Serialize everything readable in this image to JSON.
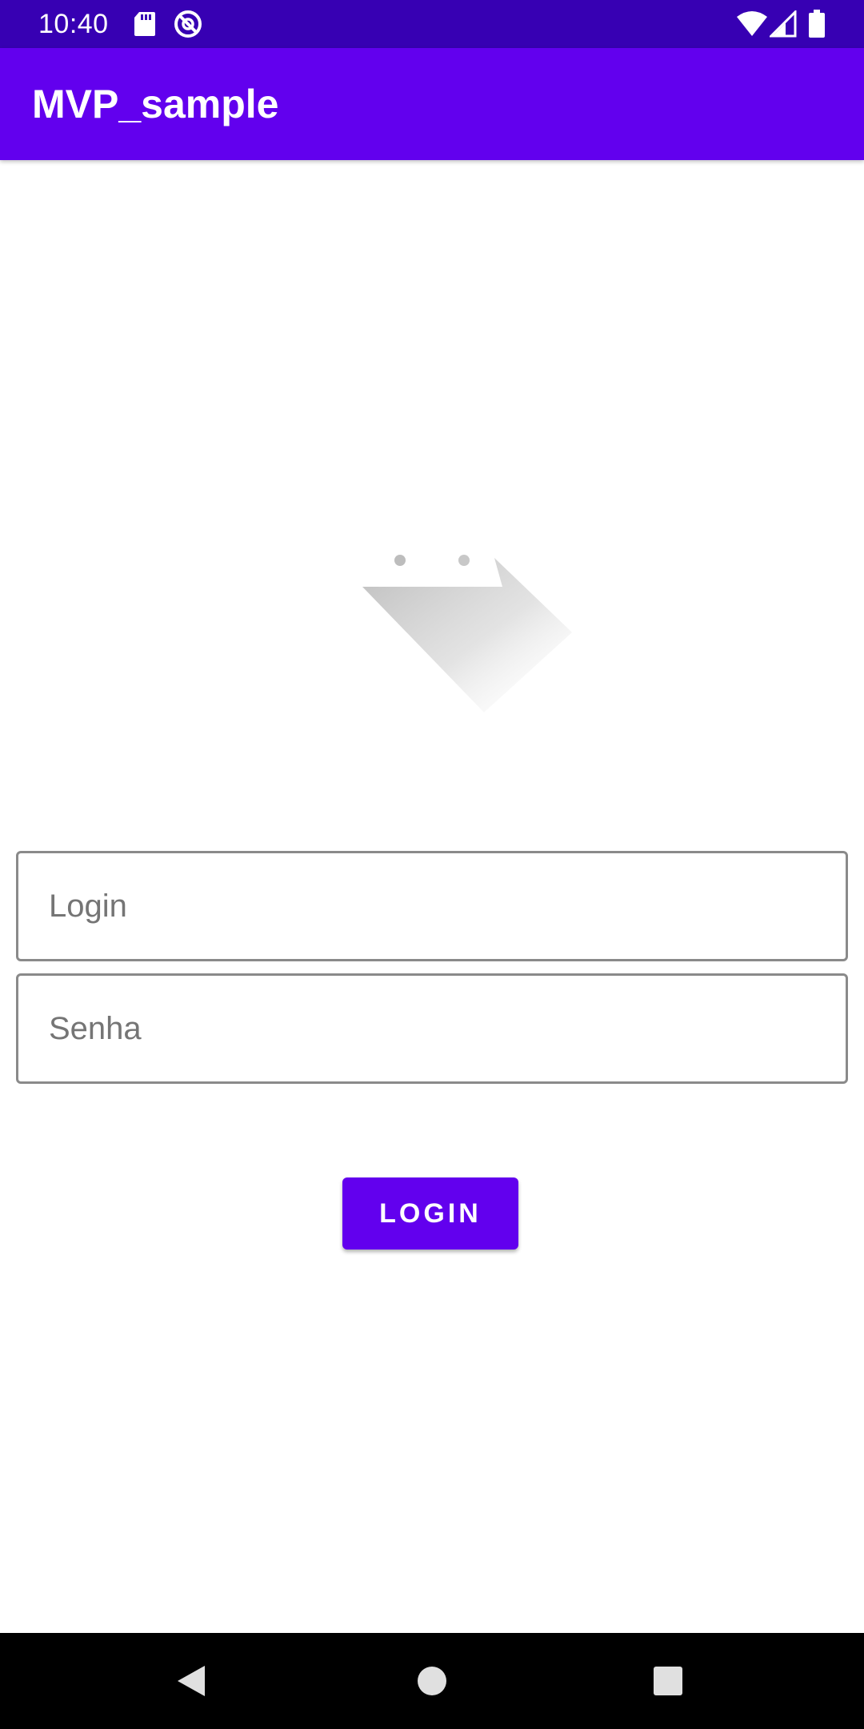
{
  "status_bar": {
    "time": "10:40",
    "background": "#3700B3",
    "icons": [
      "sd-card-icon",
      "block-icon",
      "wifi-icon",
      "signal-icon",
      "battery-icon"
    ]
  },
  "app_bar": {
    "title": "MVP_sample",
    "background": "#6200EE"
  },
  "form": {
    "login_field": {
      "placeholder": "Login",
      "value": ""
    },
    "password_field": {
      "placeholder": "Senha",
      "value": ""
    },
    "login_button": {
      "label": "LOGIN",
      "color": "#6200EE"
    }
  },
  "nav_bar": {
    "icons": [
      "back-icon",
      "home-icon",
      "recents-icon"
    ]
  }
}
